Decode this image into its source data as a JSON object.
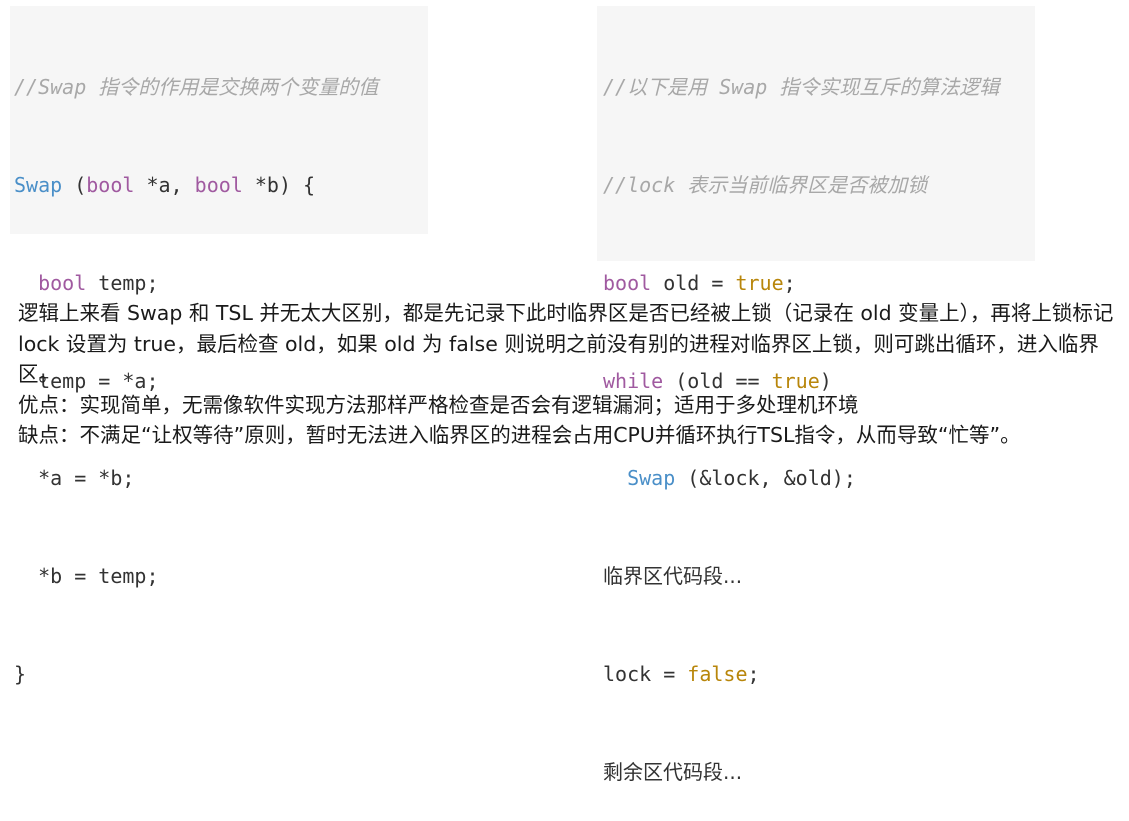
{
  "left_code": {
    "comment": "//Swap 指令的作用是交换两个变量的值",
    "sig_fn": "Swap",
    "sig_open": " (",
    "sig_kw1": "bool",
    "sig_p1": " *a, ",
    "sig_kw2": "bool",
    "sig_p2": " *b) {",
    "l2_kw": "bool",
    "l2_rest": " temp;",
    "l3": "temp = *a;",
    "l4": "*a = *b;",
    "l5": "*b = temp;",
    "l6": "}"
  },
  "right_code": {
    "comment1": "//以下是用 Swap 指令实现互斥的算法逻辑",
    "comment2": "//lock 表示当前临界区是否被加锁",
    "l3_kw": "bool",
    "l3_mid": " old = ",
    "l3_val": "true",
    "l3_end": ";",
    "l4_kw": "while",
    "l4_mid": " (old == ",
    "l4_val": "true",
    "l4_end": ")",
    "l5_fn": "Swap",
    "l5_rest": " (&lock, &old);",
    "l6": "临界区代码段...",
    "l7_mid": "lock = ",
    "l7_val": "false",
    "l7_end": ";",
    "l8": "剩余区代码段..."
  },
  "prose": {
    "para1": "逻辑上来看 Swap 和 TSL 并无太大区别，都是先记录下此时临界区是否已经被上锁（记录在 old 变量上），再将上锁标记 lock 设置为 true，最后检查 old，如果 old 为 false 则说明之前没有别的进程对临界区上锁，则可跳出循环，进入临界区。",
    "pros": "优点：实现简单，无需像软件实现方法那样严格检查是否会有逻辑漏洞；适用于多处理机环境",
    "cons": "缺点：不满足“让权等待”原则，暂时无法进入临界区的进程会占用CPU并循环执行TSL指令，从而导致“忙等”。"
  },
  "colors": {
    "comment": "#a8a8a8",
    "keyword": "#a05aa0",
    "function": "#4a8fc8",
    "boolean": "#b8860b",
    "code_bg": "#f6f6f6"
  }
}
